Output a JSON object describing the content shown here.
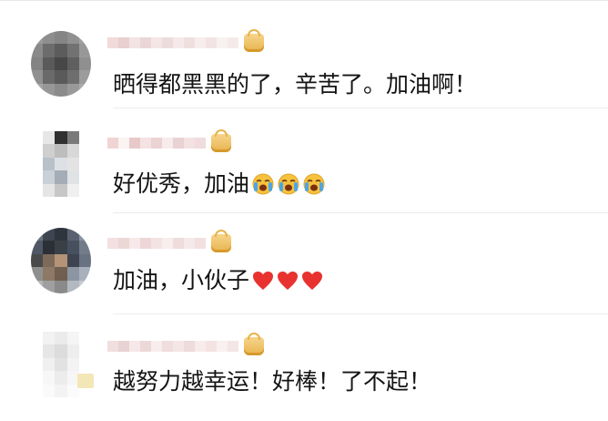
{
  "comments": [
    {
      "text": "晒得都黑黑的了，辛苦了。加油啊！",
      "emojis": [],
      "hearts": 0
    },
    {
      "text": "好优秀，加油",
      "emojis": [
        "crying-face-emoji",
        "crying-face-emoji",
        "crying-face-emoji"
      ],
      "hearts": 0
    },
    {
      "text": "加油，小伙子",
      "emojis": [],
      "hearts": 3
    },
    {
      "text": "越努力越幸运！好棒！了不起！",
      "emojis": [],
      "hearts": 0
    }
  ],
  "colors": {
    "text": "#141414",
    "divider": "#ececec",
    "badge_gold": "#e8b34d",
    "heart_red": "#e8322f"
  }
}
